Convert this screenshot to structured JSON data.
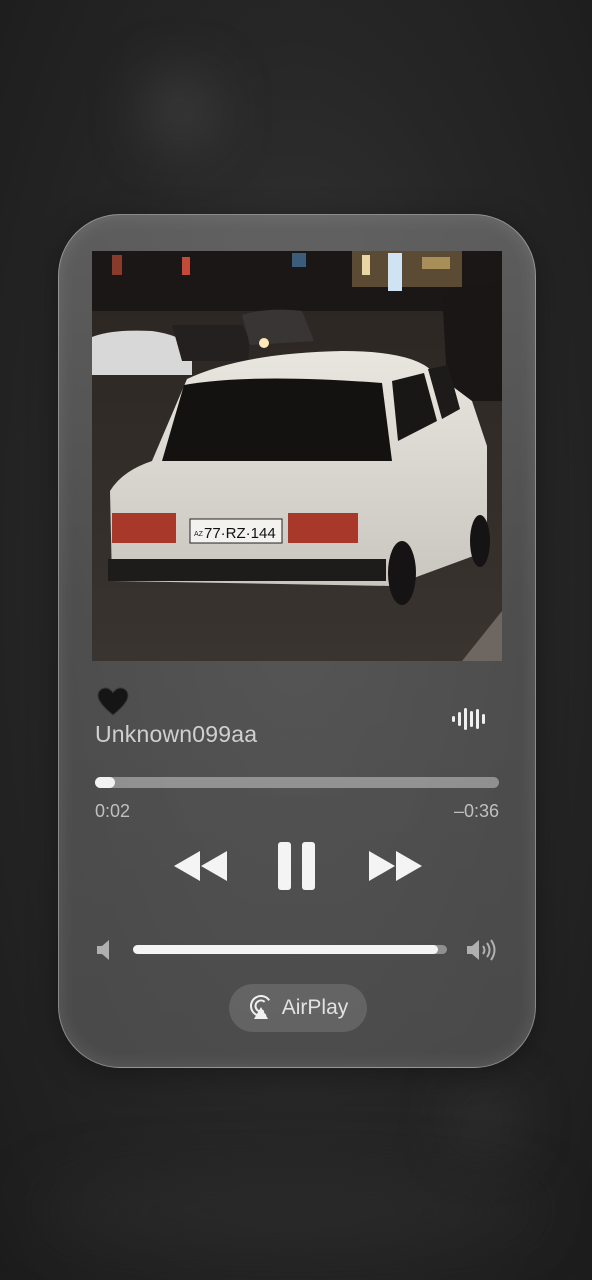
{
  "now_playing": {
    "favorite_icon": "black-heart-icon",
    "track_title": "Unknown099aa",
    "audio_indicator_icon": "waveform-icon",
    "progress": {
      "elapsed": "0:02",
      "remaining": "–0:36",
      "fraction": 0.05
    },
    "controls": {
      "previous_icon": "rewind-icon",
      "play_pause_icon": "pause-icon",
      "next_icon": "fast-forward-icon"
    },
    "volume": {
      "low_icon": "speaker-low-icon",
      "high_icon": "speaker-high-icon",
      "level": 0.97
    },
    "airplay": {
      "label": "AirPlay",
      "icon": "airplay-icon"
    },
    "artwork": {
      "plate_country": "AZ",
      "plate_number": "77·RZ·144"
    }
  },
  "colors": {
    "accent": "#f2f2f2",
    "card": "#6e6e6e",
    "background": "#262626"
  }
}
